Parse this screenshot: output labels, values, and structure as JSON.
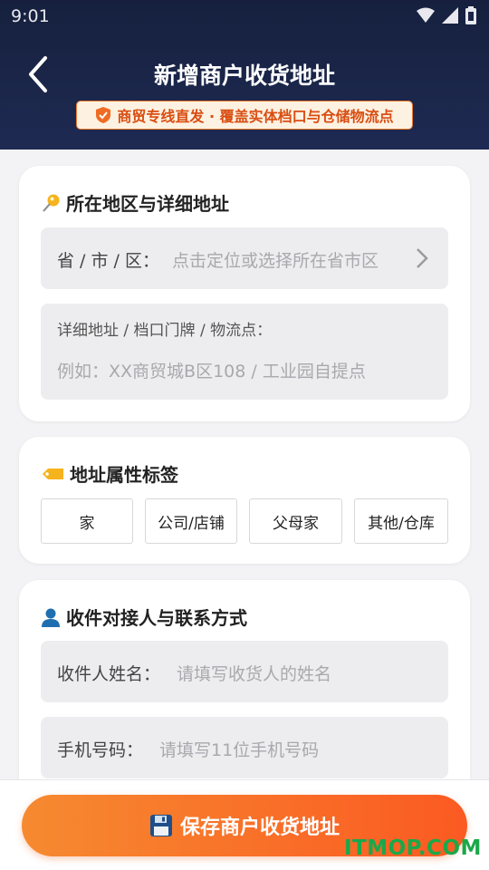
{
  "status_bar": {
    "time": "9:01"
  },
  "header": {
    "title": "新增商户收货地址",
    "badge_text": "商贸专线直发 · 覆盖实体档口与仓储物流点"
  },
  "region_card": {
    "title": "所在地区与详细地址",
    "region_label": "省 / 市 / 区：",
    "region_placeholder": "点击定位或选择所在省市区",
    "detail_label": "详细地址 / 档口门牌 / 物流点：",
    "detail_placeholder": "例如：XX商贸城B区108 / 工业园自提点"
  },
  "tags_card": {
    "title": "地址属性标签",
    "tags": [
      "家",
      "公司/店铺",
      "父母家",
      "其他/仓库"
    ]
  },
  "contact_card": {
    "title": "收件对接人与联系方式",
    "name_label": "收件人姓名：",
    "name_placeholder": "请填写收货人的姓名",
    "phone_label": "手机号码：",
    "phone_placeholder": "请填写11位手机号码"
  },
  "footer": {
    "save_label": "保存商户收货地址"
  },
  "watermark": "ITMOP.COM",
  "colors": {
    "header_bg": "#1b2548",
    "accent": "#f06b24",
    "badge_text": "#d94e12",
    "watermark": "#1aa84a"
  }
}
